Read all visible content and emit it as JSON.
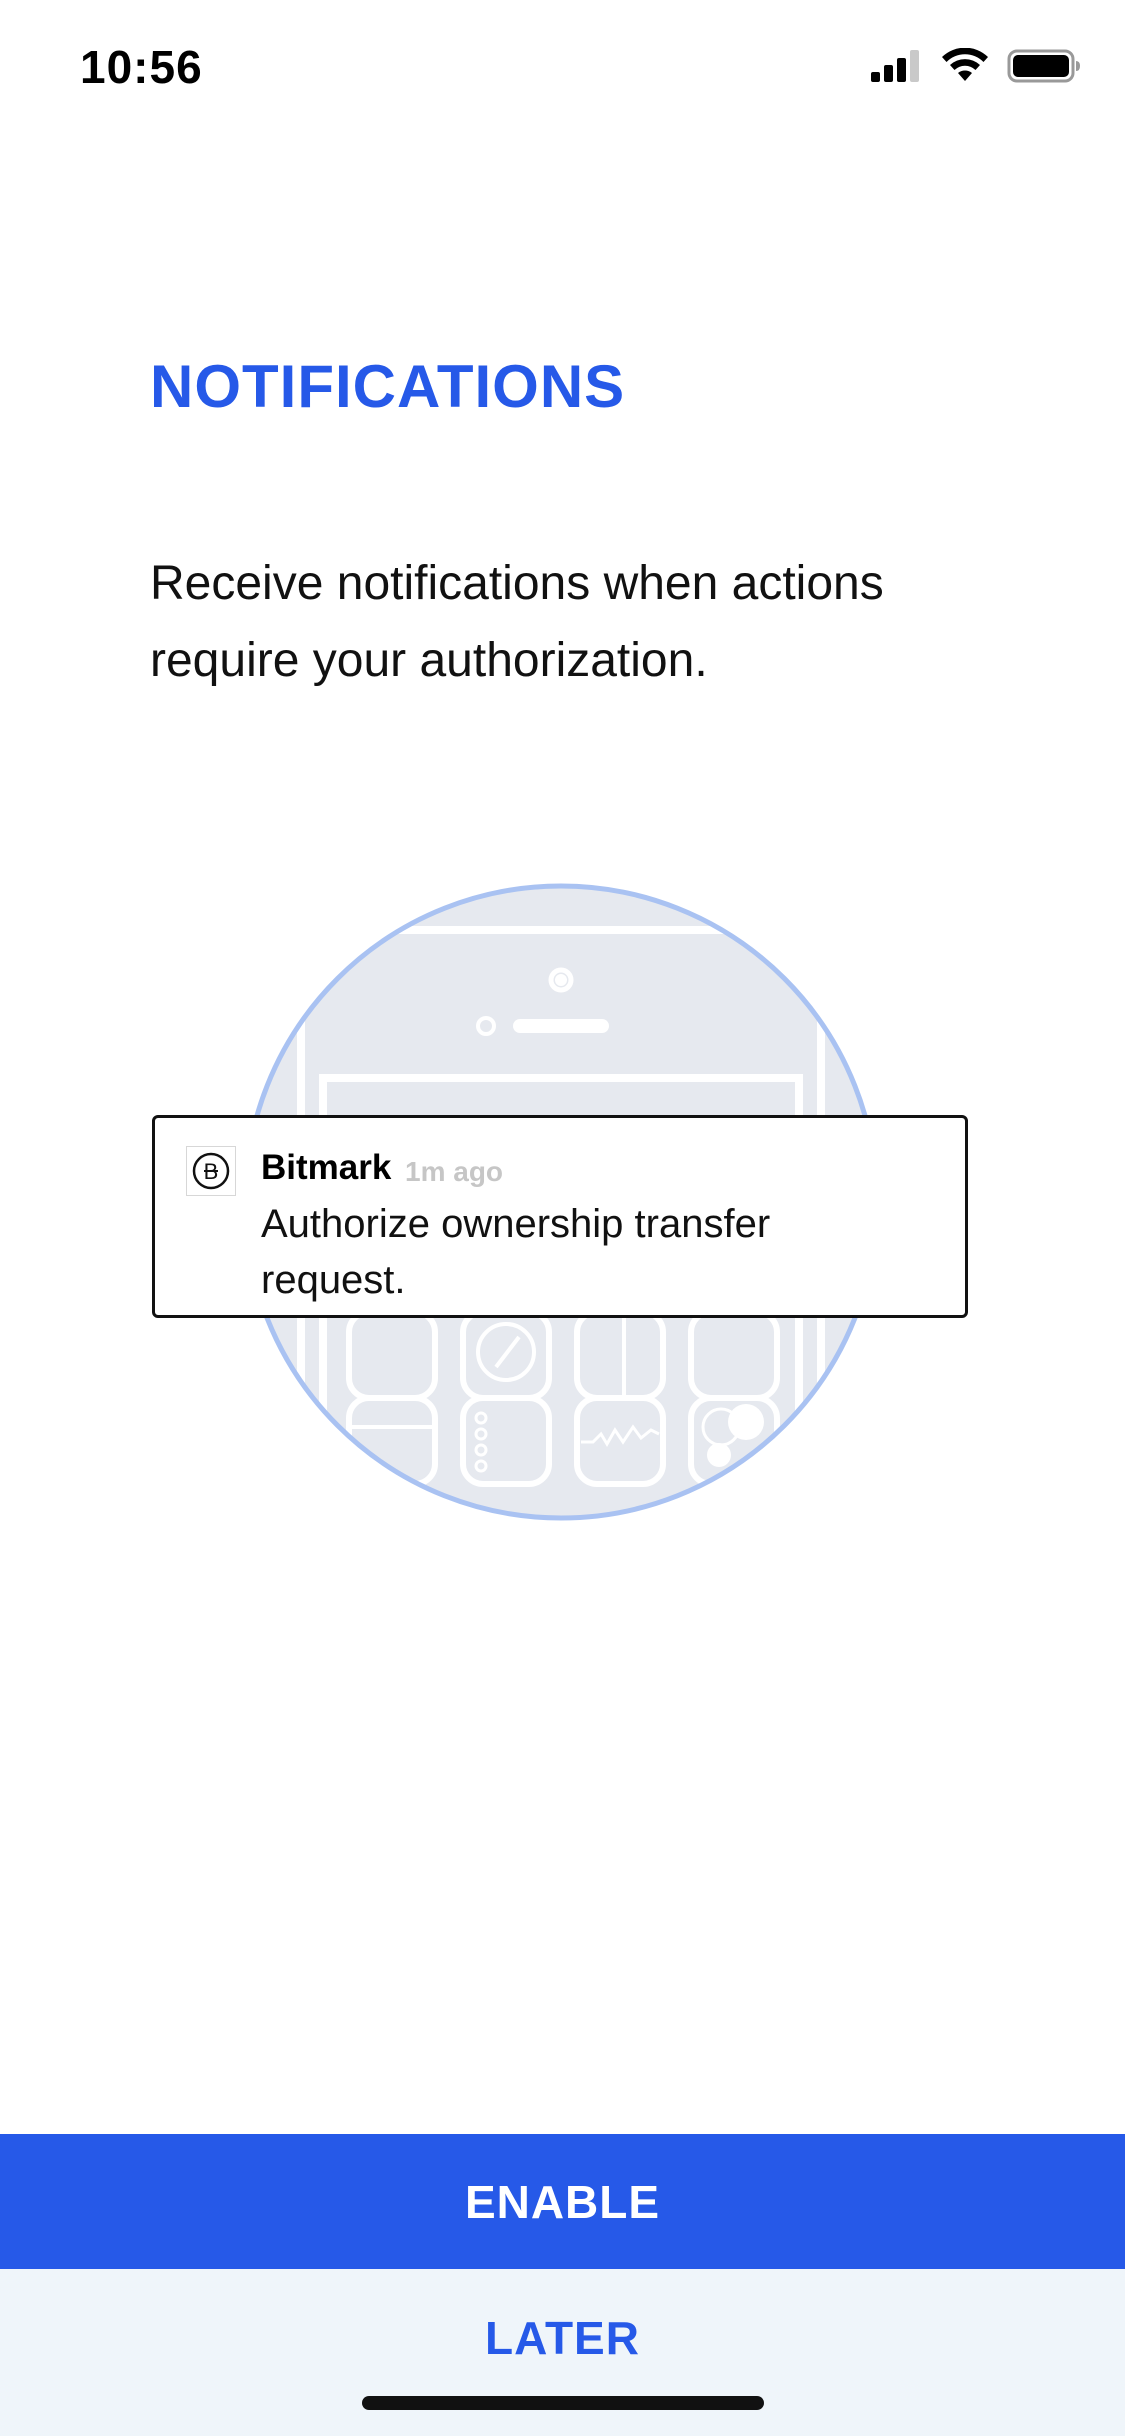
{
  "status_bar": {
    "time": "10:56",
    "icons": [
      "signal-icon",
      "wifi-icon",
      "battery-icon"
    ]
  },
  "page": {
    "title": "NOTIFICATIONS",
    "description": "Receive notifications when actions require your authorization."
  },
  "notification": {
    "app_icon": "bitmark-logo-icon",
    "app_name": "Bitmark",
    "time_ago": "1m ago",
    "message": "Authorize ownership transfer request."
  },
  "buttons": {
    "enable_label": "ENABLE",
    "later_label": "LATER"
  },
  "colors": {
    "accent": "#2659e8",
    "later_background": "#eff5fa",
    "illustration_fill": "#e6e9ef",
    "illustration_ring": "#a9c2f2"
  }
}
